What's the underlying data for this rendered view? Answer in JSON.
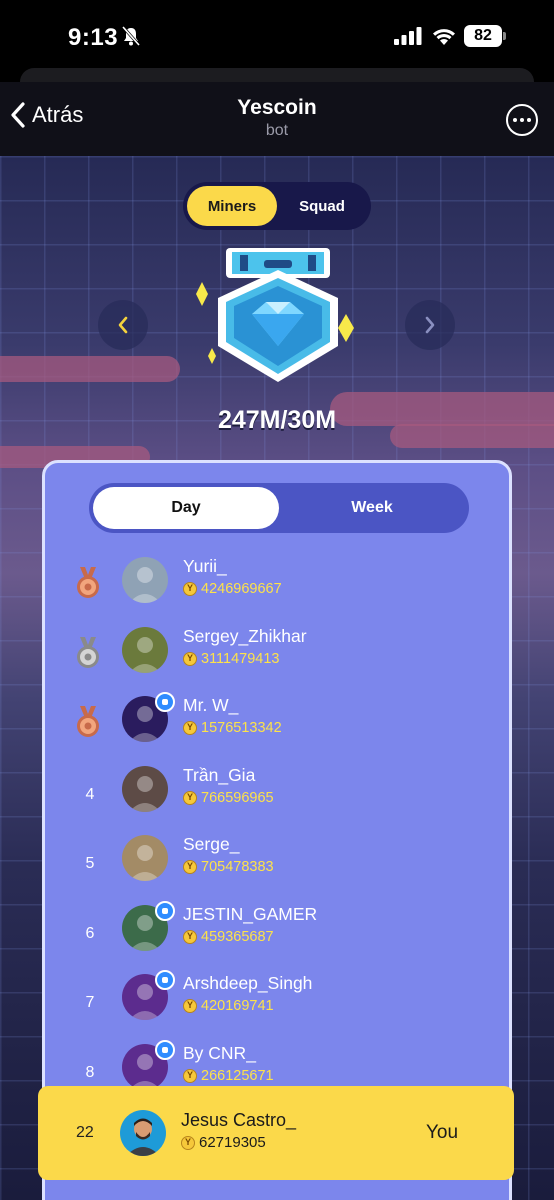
{
  "status_bar": {
    "time": "9:13",
    "battery": "82"
  },
  "nav": {
    "back_label": "Atrás",
    "title": "Yescoin",
    "subtitle": "bot"
  },
  "top_tabs": [
    {
      "label": "Miners",
      "active": true
    },
    {
      "label": "Squad",
      "active": false
    }
  ],
  "level": {
    "progress": "247M/30M"
  },
  "period_tabs": [
    {
      "label": "Day",
      "active": true
    },
    {
      "label": "Week",
      "active": false
    }
  ],
  "leaderboard": [
    {
      "rank": "1",
      "medal": "bronze",
      "name": "Yurii_",
      "score": "4246969667",
      "verified": false,
      "avatar_color": "#8fa2b5"
    },
    {
      "rank": "2",
      "medal": "silver",
      "name": "Sergey_Zhikhar",
      "score": "3111479413",
      "verified": false,
      "avatar_color": "#6b7a3c"
    },
    {
      "rank": "3",
      "medal": "bronze",
      "name": "Mr. W_",
      "score": "1576513342",
      "verified": true,
      "avatar_color": "#2a1c5e"
    },
    {
      "rank": "4",
      "medal": "",
      "name": "Trần_Gia",
      "score": "766596965",
      "verified": false,
      "avatar_color": "#5d4b46"
    },
    {
      "rank": "5",
      "medal": "",
      "name": "Serge_",
      "score": "705478383",
      "verified": false,
      "avatar_color": "#a38b66"
    },
    {
      "rank": "6",
      "medal": "",
      "name": "JESTIN_GAMER",
      "score": "459365687",
      "verified": true,
      "avatar_color": "#3c6b4a"
    },
    {
      "rank": "7",
      "medal": "",
      "name": "Arshdeep_Singh",
      "score": "420169741",
      "verified": true,
      "avatar_color": "#5c2c8e"
    },
    {
      "rank": "8",
      "medal": "",
      "name": "By CNR_",
      "score": "266125671",
      "verified": true,
      "avatar_color": "#5c2c8e"
    }
  ],
  "current_user": {
    "rank": "22",
    "name": "Jesus Castro_",
    "score": "62719305",
    "you_label": "You"
  },
  "colors": {
    "accent_yellow": "#fbd94a",
    "panel": "#7c86ec",
    "score": "#fde24a"
  }
}
